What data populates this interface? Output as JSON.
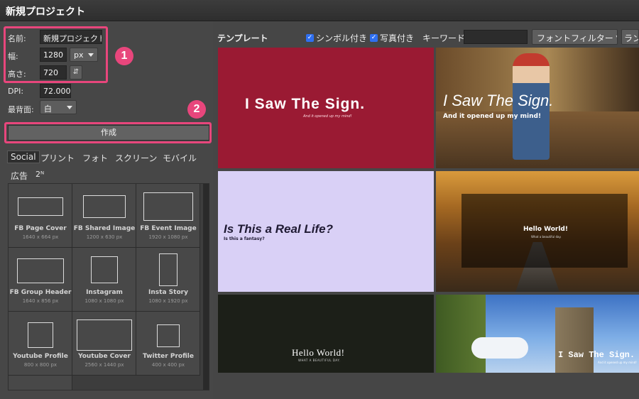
{
  "window": {
    "title": "新規プロジェクト"
  },
  "form": {
    "name_label": "名前:",
    "name_value": "新規プロジェクト",
    "width_label": "幅:",
    "width_value": "1280",
    "unit": "px",
    "height_label": "高さ:",
    "height_value": "720",
    "swap_icon": "⇵",
    "dpi_label": "DPI:",
    "dpi_value": "72.000",
    "bg_label": "最背面:",
    "bg_value": "白",
    "create_label": "作成"
  },
  "annotations": {
    "badge1": "1",
    "badge2": "2"
  },
  "categories": {
    "tabs": [
      "Social",
      "プリント",
      "フォト",
      "スクリーン",
      "モバイル",
      "広告",
      "2ᴺ"
    ],
    "active": "Social"
  },
  "presets": [
    {
      "name": "FB Page Cover",
      "size": "1640 x 664 px"
    },
    {
      "name": "FB Shared Image",
      "size": "1200 x 630 px"
    },
    {
      "name": "FB Event Image",
      "size": "1920 x 1080 px"
    },
    {
      "name": "FB Group Header",
      "size": "1640 x 856 px"
    },
    {
      "name": "Instagram",
      "size": "1080 x 1080 px"
    },
    {
      "name": "Insta Story",
      "size": "1080 x 1920 px"
    },
    {
      "name": "Youtube Profile",
      "size": "800 x 800 px"
    },
    {
      "name": "Youtube Cover",
      "size": "2560 x 1440 px"
    },
    {
      "name": "Twitter Profile",
      "size": "400 x 400 px"
    }
  ],
  "templates_bar": {
    "heading": "テンプレート",
    "symbols_label": "シンボル付き",
    "photos_label": "写真付き",
    "keyword_label": "キーワード:",
    "font_filter": "フォントフィルター ▼",
    "random": "ラン"
  },
  "templates": [
    {
      "title": "I Saw The Sign.",
      "sub": "And it opened up my mind!"
    },
    {
      "title": "I Saw The Sign.",
      "sub": "And it opened up my mind!"
    },
    {
      "title": "Is This a Real Life?",
      "sub": "Is this a fantasy?"
    },
    {
      "title": "Hello World!",
      "sub": "What a beautiful day."
    },
    {
      "title": "Hello World!",
      "sub": "WHAT A BEAUTIFUL DAY."
    },
    {
      "title": "I Saw The Sign.",
      "sub": "And it opened up my mind!"
    }
  ],
  "colors": {
    "accent": "#e8467c",
    "template_red": "#9a1a33",
    "template_lavender": "#d9d0f6",
    "template_dark": "#1c1f18"
  }
}
